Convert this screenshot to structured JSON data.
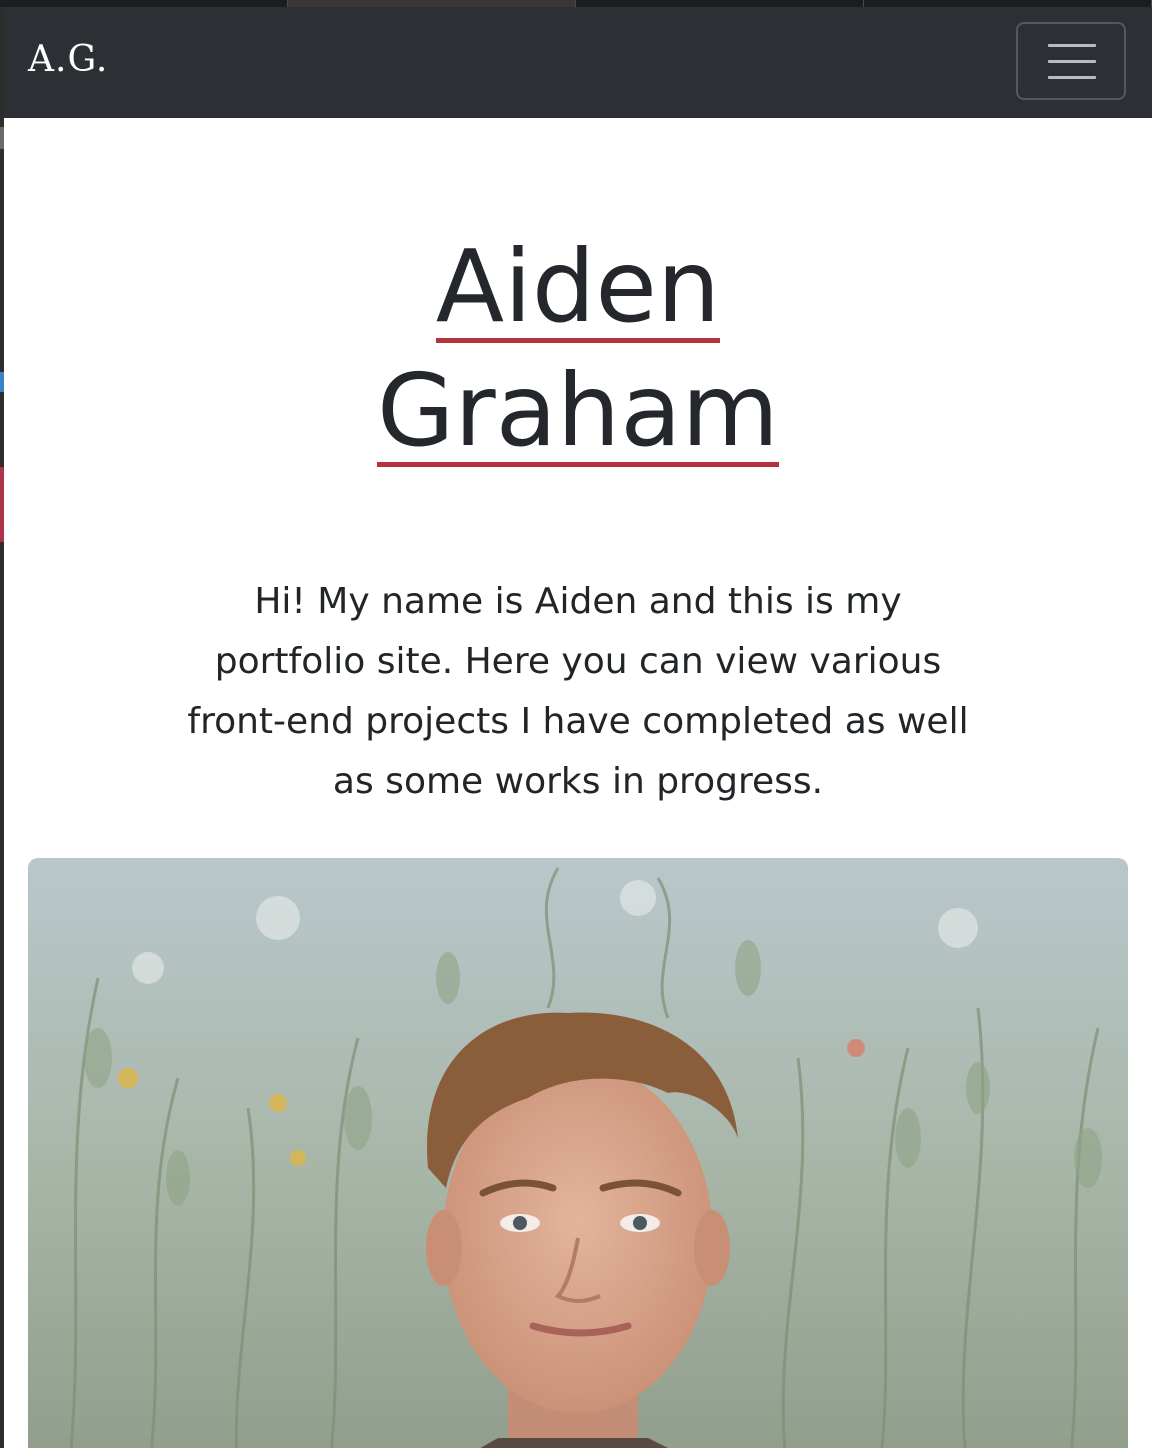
{
  "navbar": {
    "brand": "A.G.",
    "colors": {
      "background": "#2c2f34",
      "brand_text": "#ffffff"
    }
  },
  "hero": {
    "first_name": "Aiden",
    "last_name": "Graham",
    "underline_color": "#b3333e",
    "intro": "Hi! My name is Aiden and this is my portfolio site. Here you can view various front-end projects I have completed as well as some works in progress."
  },
  "icons": {
    "menu": "hamburger-menu-icon"
  }
}
